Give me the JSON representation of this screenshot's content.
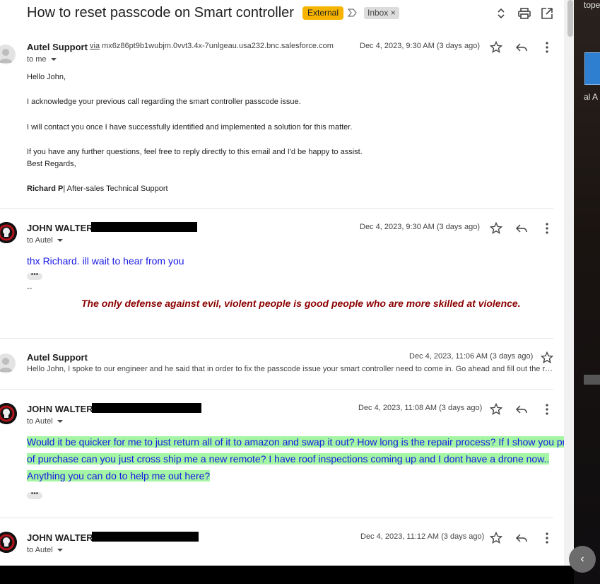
{
  "thread": {
    "subject": "How to reset passcode on Smart controller",
    "external_label": "External",
    "inbox_label": "Inbox",
    "inbox_remove": "×"
  },
  "messages": [
    {
      "sender": "Autel Support",
      "via_prefix": "via",
      "via_address": "mx6z86pt9b1wubjm.0vvt3.4x-7unlgeau.usa232.bnc.salesforce.com",
      "to": "to me",
      "date": "Dec 4, 2023, 9:30 AM (3 days ago)",
      "body": [
        "Hello John,",
        "I acknowledge your previous call regarding the smart controller passcode issue.",
        "I will contact you once I have successfully identified and implemented a solution for this matter.",
        "If you have any further questions, feel free to reply directly to this email and I'd be happy to assist.",
        "Best Regards,"
      ],
      "signature_name": "Richard P",
      "signature_title": "| After-sales Technical Support"
    },
    {
      "sender": "JOHN WALTER",
      "to": "to Autel",
      "date": "Dec 4, 2023, 9:30 AM (3 days ago)",
      "body": "thx Richard. ill wait to hear from you",
      "ellipsis": "•••",
      "sig_dash": "--",
      "quote": "The only defense against evil, violent people is good people who are more skilled at violence."
    },
    {
      "sender": "Autel Support",
      "date": "Dec 4, 2023, 11:06 AM (3 days ago)",
      "snippet": "Hello John, I spoke to our engineer and he said that in order to fix the passcode issue your smart controller need to come in. Go ahead and fill out the repair form"
    },
    {
      "sender": "JOHN WALTER",
      "to": "to Autel",
      "date": "Dec 4, 2023, 11:08 AM (3 days ago)",
      "body_lines": [
        "Would it be quicker for me to just return all of it to amazon and swap it out? How long is the repair process? If I show you proof",
        "of purchase can you just cross ship me a new remote? I have roof inspections coming up and I dont have a drone now..",
        "Anything you can do to help me out here?"
      ],
      "ellipsis": "•••"
    },
    {
      "sender": "JOHN WALTER",
      "to": "to Autel",
      "date": "Dec 4, 2023, 11:12 AM (3 days ago)"
    }
  ],
  "right_panel": {
    "text_top": "tope",
    "text_mid": "al A",
    "back_glyph": "‹"
  },
  "colors": {
    "external_badge": "#f6b400",
    "highlight": "#a4f5a4",
    "blue_text": "#1919e6",
    "quote": "#8b0000"
  }
}
